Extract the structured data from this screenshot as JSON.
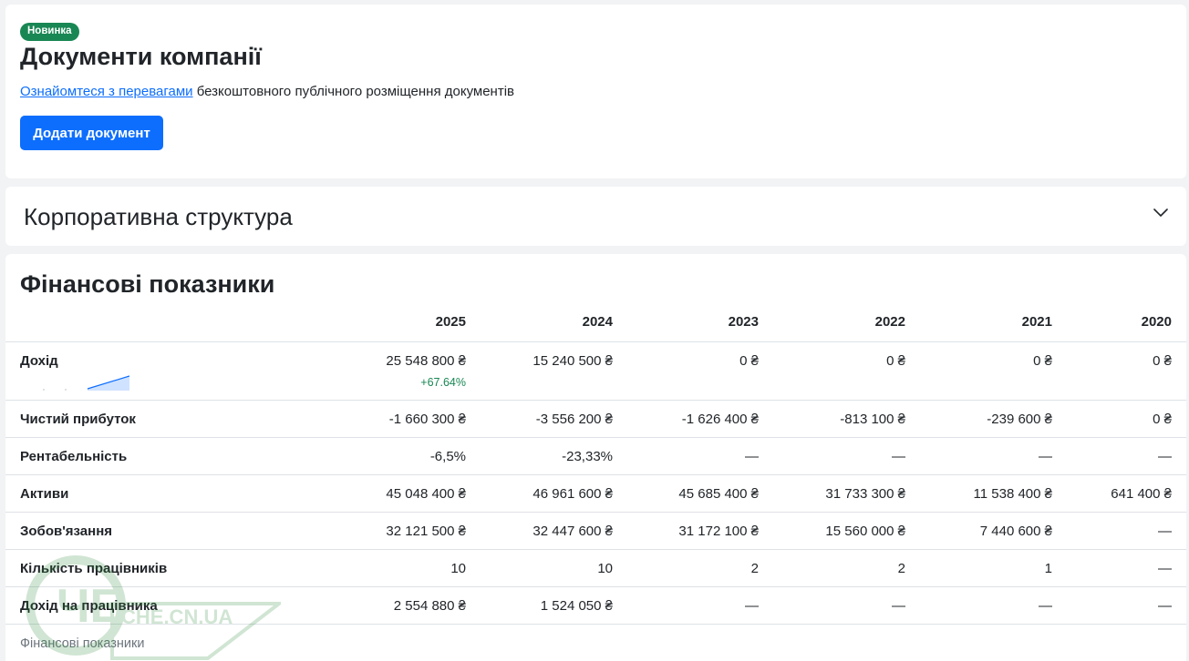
{
  "docs": {
    "badge": "Новинка",
    "title": "Документи компанії",
    "link_text": "Ознайомтеся з перевагами",
    "subtitle_rest": " безкоштовного публічного розміщення документів",
    "add_button": "Додати документ"
  },
  "corp": {
    "title": "Корпоративна структура",
    "toggle_icon": "chevron-down-icon"
  },
  "finance": {
    "title": "Фінансові показники",
    "years": [
      "2025",
      "2024",
      "2023",
      "2022",
      "2021",
      "2020"
    ],
    "rows": [
      {
        "label": "Дохід",
        "values": [
          "25 548 800 ₴",
          "15 240 500 ₴",
          "0 ₴",
          "0 ₴",
          "0 ₴",
          "0 ₴"
        ],
        "growth": "+67.64%"
      },
      {
        "label": "Чистий прибуток",
        "values": [
          "-1 660 300 ₴",
          "-3 556 200 ₴",
          "-1 626 400 ₴",
          "-813 100 ₴",
          "-239 600 ₴",
          "0 ₴"
        ]
      },
      {
        "label": "Рентабельність",
        "values": [
          "-6,5%",
          "-23,33%",
          "—",
          "—",
          "—",
          "—"
        ]
      },
      {
        "label": "Активи",
        "values": [
          "45 048 400 ₴",
          "46 961 600 ₴",
          "45 685 400 ₴",
          "31 733 300 ₴",
          "11 538 400 ₴",
          "641 400 ₴"
        ]
      },
      {
        "label": "Зобов'язання",
        "values": [
          "32 121 500 ₴",
          "32 447 600 ₴",
          "31 172 100 ₴",
          "15 560 000 ₴",
          "7 440 600 ₴",
          "—"
        ]
      },
      {
        "label": "Кількість працівників",
        "values": [
          "10",
          "10",
          "2",
          "2",
          "1",
          "—"
        ]
      },
      {
        "label": "Дохід на працівника",
        "values": [
          "2 554 880 ₴",
          "1 524 050 ₴",
          "—",
          "—",
          "—",
          "—"
        ]
      }
    ],
    "caption": "Фінансові показники"
  },
  "watermark": {
    "text": "CHE.CN.UA",
    "logo": "ЧЕ"
  },
  "colors": {
    "primary": "#0d6efd",
    "success": "#198754",
    "spark_line": "#0d6efd",
    "spark_fill": "#cfe2ff"
  }
}
